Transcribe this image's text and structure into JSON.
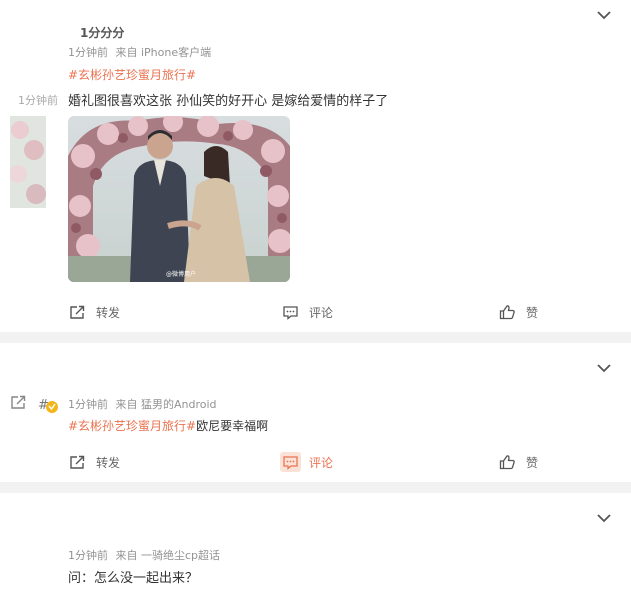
{
  "posts": [
    {
      "ghost_title": "1分分分",
      "ghost_time": "1分钟前",
      "time": "1分钟前",
      "source": "来自 iPhone客户端",
      "topic": "#玄彬孙艺珍蜜月旅行#",
      "text": "婚礼图很喜欢这张 孙仙笑的好开心 是嫁给爱情的样子了",
      "image_watermark": "@微博用户"
    },
    {
      "time": "1分钟前",
      "source": "来自 猛男的Android",
      "topic": "#玄彬孙艺珍蜜月旅行#",
      "text": "欧尼要幸福啊"
    },
    {
      "time": "1分钟前",
      "source": "来自 一骑绝尘cp超话",
      "text": "问：怎么没一起出来？"
    }
  ],
  "actions": {
    "repost": "转发",
    "comment": "评论",
    "like": "赞"
  },
  "colors": {
    "accent": "#eb7350",
    "meta": "#939393",
    "background": "#f2f2f2"
  },
  "icons": [
    "chevron-down-icon",
    "repost-icon",
    "comment-icon",
    "like-icon",
    "medal-icon"
  ]
}
